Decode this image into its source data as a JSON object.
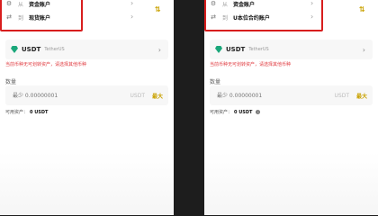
{
  "left": {
    "from_prefix": "从",
    "from_account": "资金账户",
    "to_prefix": "到",
    "to_account": "现货账户",
    "coin_symbol": "USDT",
    "coin_name": "TetherUS",
    "warning": "当前币种无可划转资产，请选择其他币种",
    "quantity_label": "数量",
    "quantity_placeholder": "最少 0.00000001",
    "unit": "USDT",
    "max_label": "最大",
    "available_label": "可用资产：",
    "available_value": "0 USDT"
  },
  "right": {
    "from_prefix": "从",
    "from_account": "资金账户",
    "to_prefix": "到",
    "to_account": "U本位合约账户",
    "coin_symbol": "USDT",
    "coin_name": "TetherUS",
    "warning": "当前币种无可划转资产，请选择其他币种",
    "quantity_label": "数量",
    "quantity_placeholder": "最少 0.00000001",
    "unit": "USDT",
    "max_label": "最大",
    "available_label": "可用资产：",
    "available_value": "0 USDT"
  },
  "colors": {
    "highlight": "#d81e1e",
    "accent": "#c9a100",
    "warning": "#e0393e",
    "coin_icon": "#1aa77a"
  }
}
